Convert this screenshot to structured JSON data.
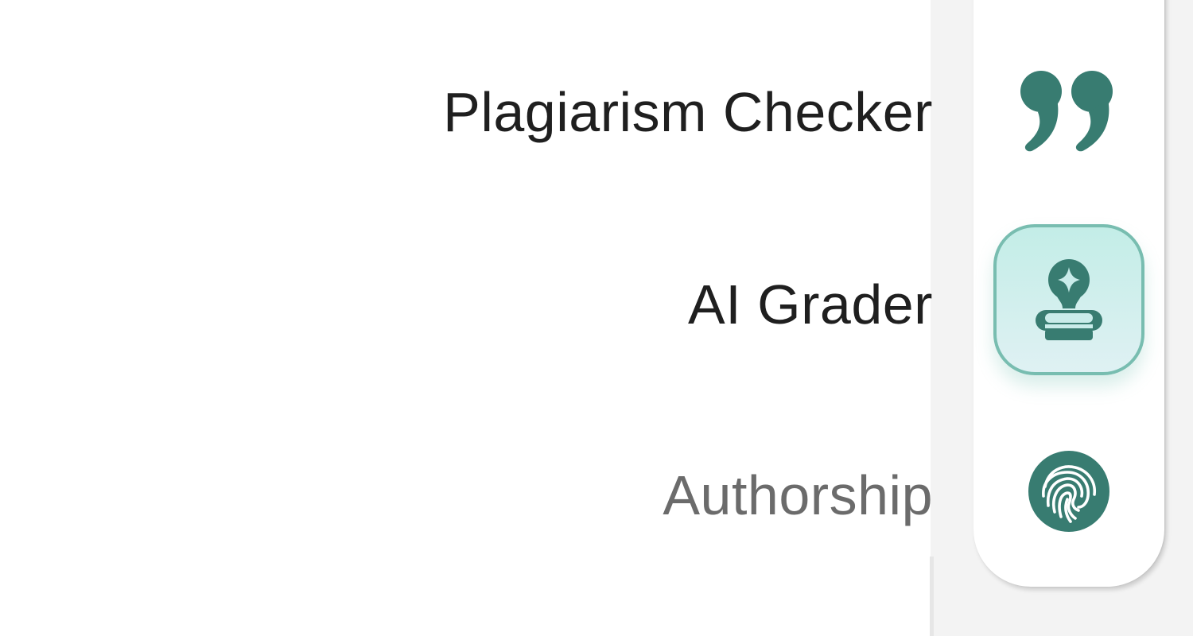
{
  "tools": {
    "plagiarism_label": "Plagiarism Checker",
    "ai_grader_label": "AI Grader",
    "authorship_label": "Authorship",
    "active": "AI Grader"
  },
  "icons": {
    "plagiarism": "quote-icon",
    "ai_grader": "stamp-sparkle-icon",
    "authorship": "fingerprint-icon"
  },
  "colors": {
    "accent": "#387c71",
    "active_bg": "#c3ede7",
    "active_border": "#78bdb0",
    "label_primary": "#1f1f1f",
    "label_muted": "#6b6b6b"
  }
}
